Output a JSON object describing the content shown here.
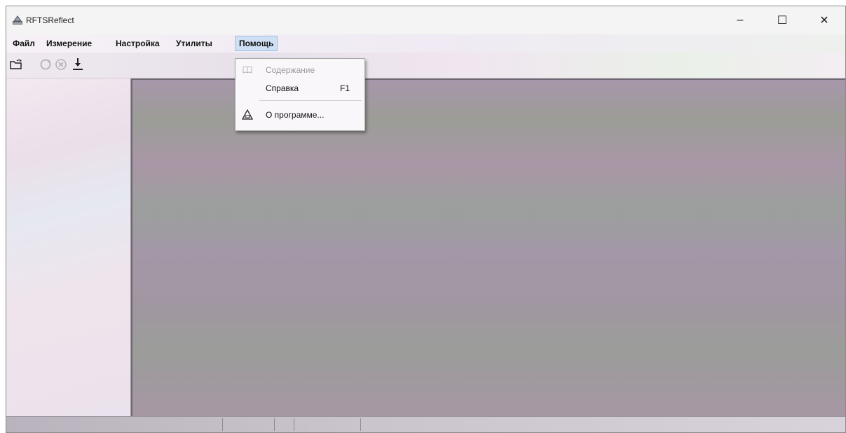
{
  "window": {
    "title": "RFTSReflect",
    "controls": {
      "minimize": "–",
      "maximize": "☐",
      "close": "✕"
    }
  },
  "menubar": {
    "items": [
      {
        "label": "Файл"
      },
      {
        "label": "Измерение"
      },
      {
        "label": "Настройка"
      },
      {
        "label": "Утилиты"
      },
      {
        "label": "Помощь",
        "active": true
      }
    ]
  },
  "toolbar": {
    "buttons": [
      {
        "icon": "open-folder-icon"
      },
      {
        "icon": "refresh-icon"
      },
      {
        "icon": "stop-icon"
      },
      {
        "icon": "download-icon"
      }
    ]
  },
  "help_menu": {
    "items": [
      {
        "label": "Содержание",
        "disabled": true,
        "icon": "book-icon",
        "shortcut": ""
      },
      {
        "label": "Справка",
        "disabled": false,
        "icon": "",
        "shortcut": "F1"
      },
      {
        "label": "О программе...",
        "disabled": false,
        "icon": "about-icon",
        "shortcut": ""
      }
    ]
  },
  "colors": {
    "menu_highlight": "#cfe0f5",
    "disabled_text": "#9a9a9a"
  }
}
